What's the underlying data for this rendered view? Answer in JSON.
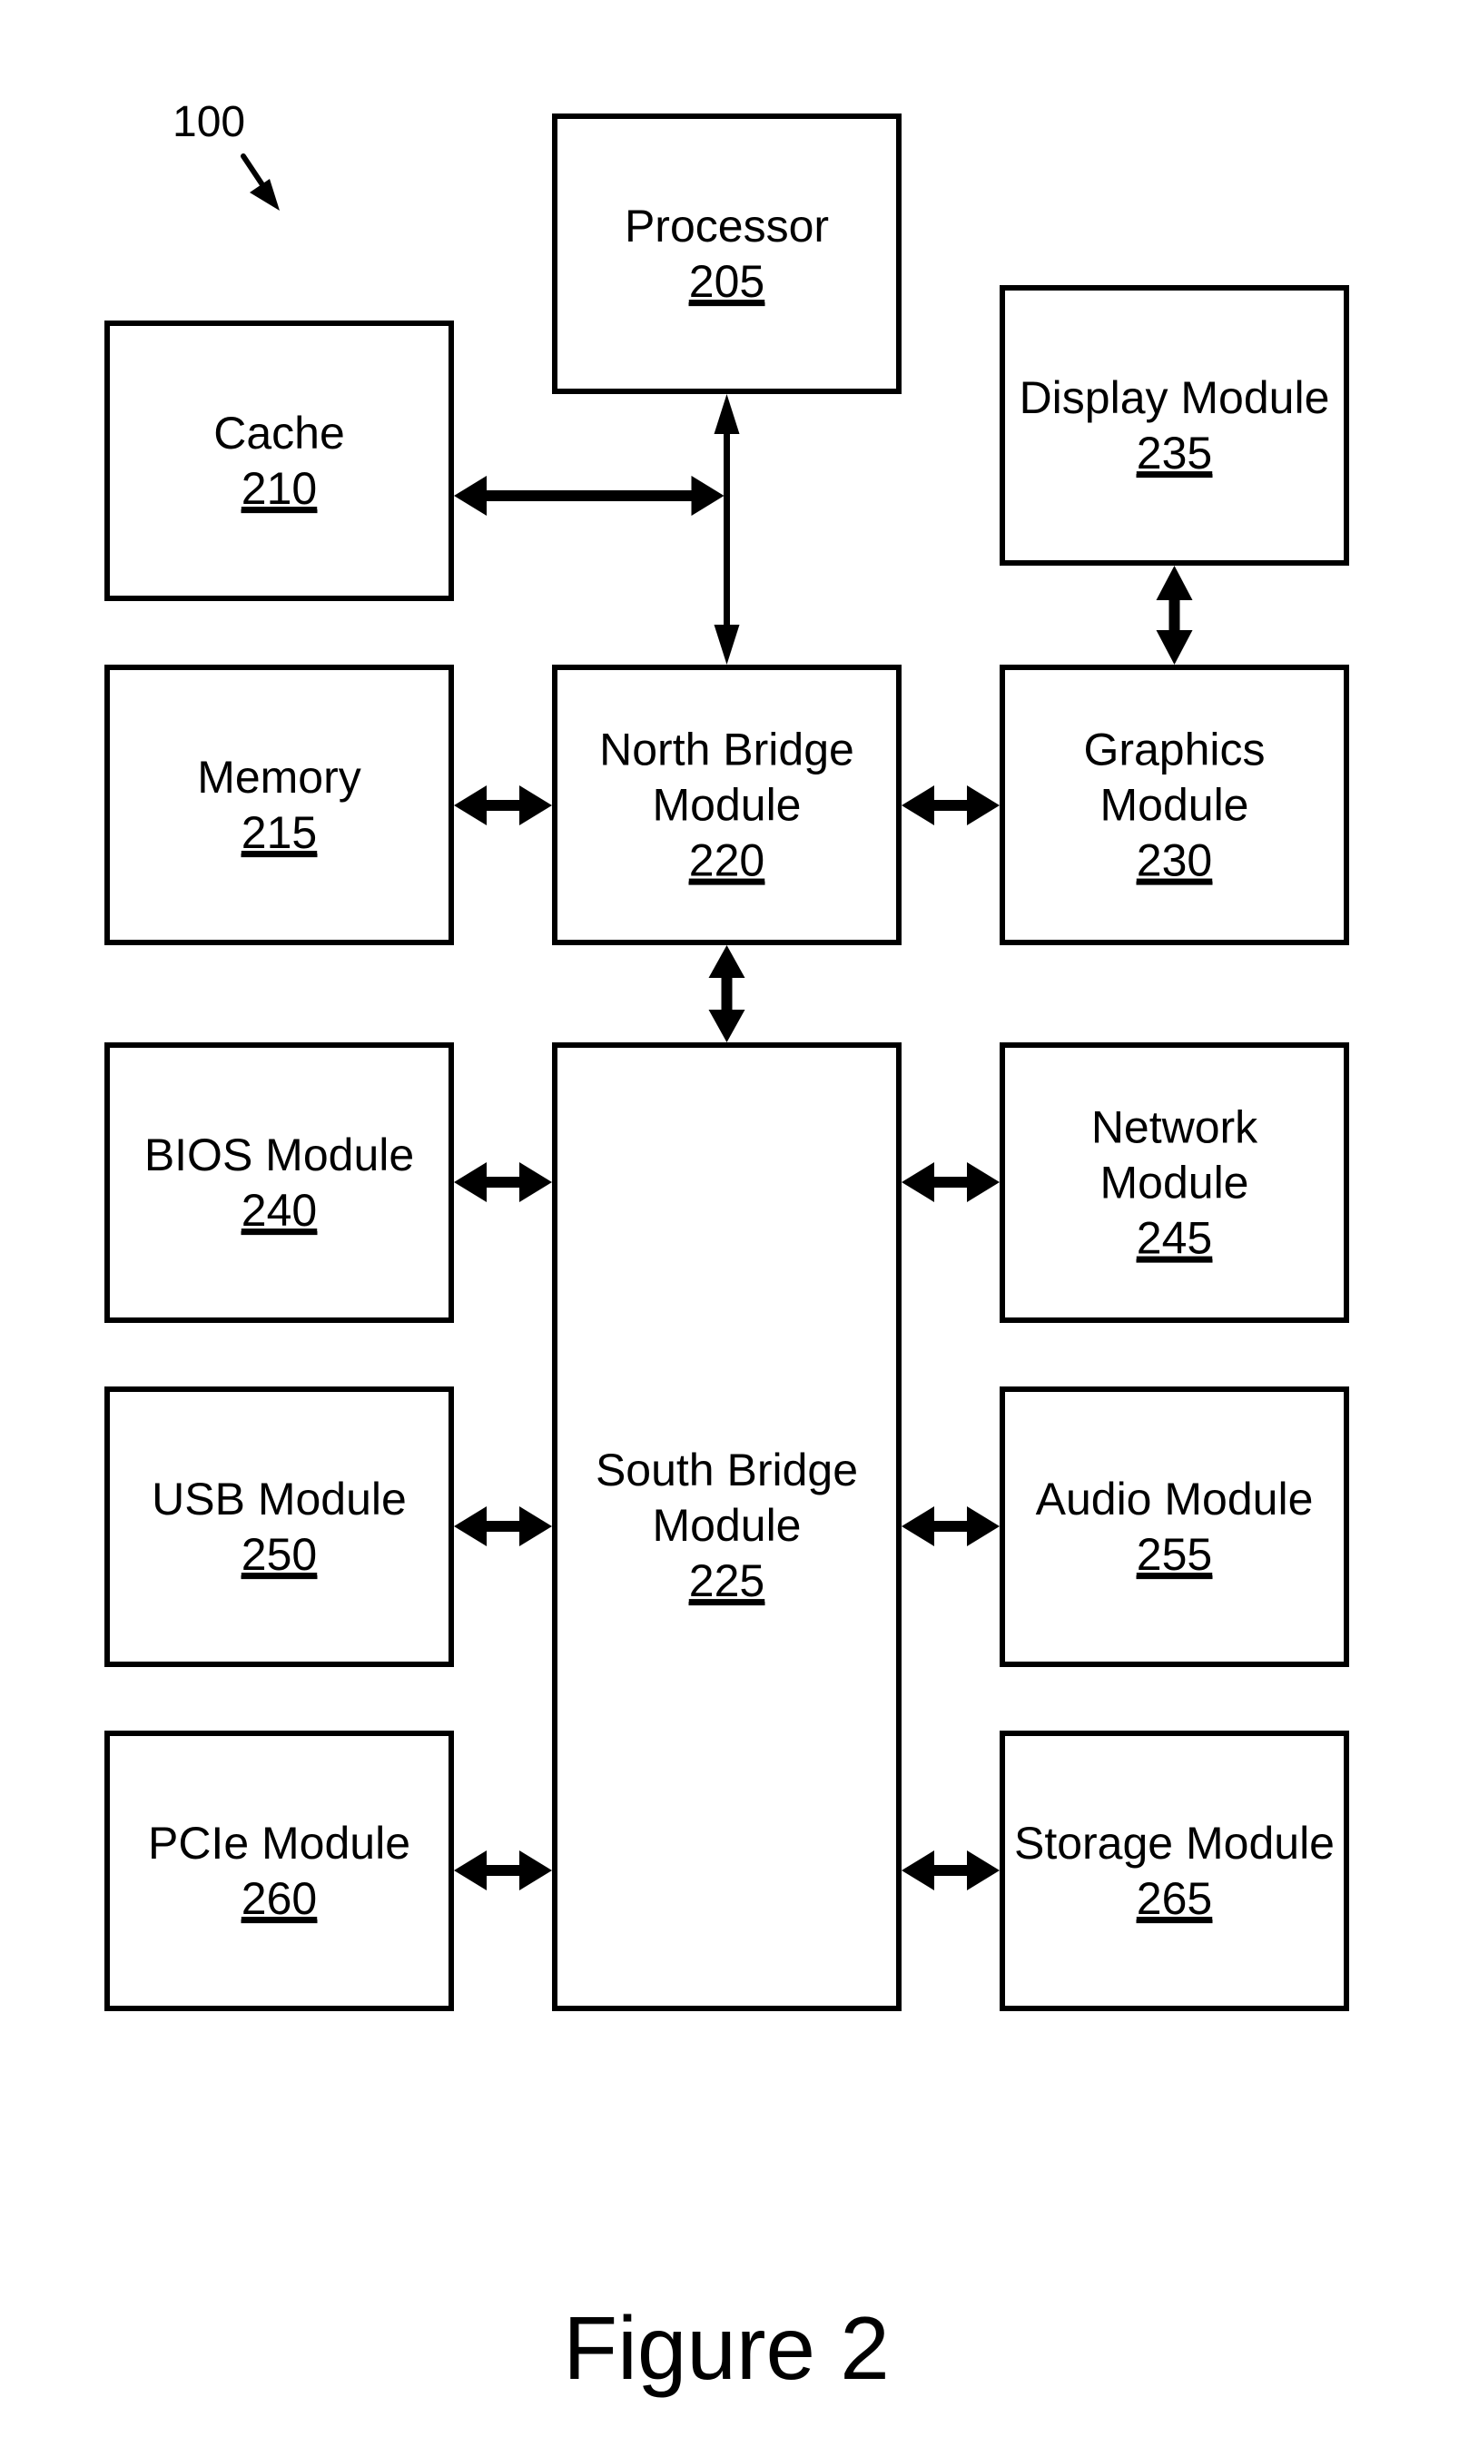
{
  "figure": {
    "caption": "Figure 2",
    "reference_label": "100"
  },
  "colors": {
    "stroke": "#000000",
    "background": "#ffffff"
  },
  "boxes": [
    {
      "id": "processor",
      "lines": [
        "Processor"
      ],
      "ref": "205"
    },
    {
      "id": "cache",
      "lines": [
        "Cache"
      ],
      "ref": "210"
    },
    {
      "id": "display",
      "lines": [
        "Display Module"
      ],
      "ref": "235"
    },
    {
      "id": "memory",
      "lines": [
        "Memory"
      ],
      "ref": "215"
    },
    {
      "id": "north-bridge",
      "lines": [
        "North Bridge",
        "Module"
      ],
      "ref": "220"
    },
    {
      "id": "graphics",
      "lines": [
        "Graphics",
        "Module"
      ],
      "ref": "230"
    },
    {
      "id": "bios",
      "lines": [
        "BIOS Module"
      ],
      "ref": "240"
    },
    {
      "id": "south-bridge",
      "lines": [
        "South Bridge",
        "Module"
      ],
      "ref": "225"
    },
    {
      "id": "network",
      "lines": [
        "Network",
        "Module"
      ],
      "ref": "245"
    },
    {
      "id": "usb",
      "lines": [
        "USB Module"
      ],
      "ref": "250"
    },
    {
      "id": "audio",
      "lines": [
        "Audio Module"
      ],
      "ref": "255"
    },
    {
      "id": "pcie",
      "lines": [
        "PCIe Module"
      ],
      "ref": "260"
    },
    {
      "id": "storage",
      "lines": [
        "Storage Module"
      ],
      "ref": "265"
    }
  ],
  "connections": [
    {
      "from": "processor",
      "to": "north-bridge",
      "type": "bidirectional"
    },
    {
      "from": "cache",
      "to": "processor-north-bridge-bus",
      "type": "bidirectional"
    },
    {
      "from": "display",
      "to": "graphics",
      "type": "bidirectional"
    },
    {
      "from": "memory",
      "to": "north-bridge",
      "type": "bidirectional"
    },
    {
      "from": "north-bridge",
      "to": "graphics",
      "type": "bidirectional"
    },
    {
      "from": "north-bridge",
      "to": "south-bridge",
      "type": "bidirectional"
    },
    {
      "from": "bios",
      "to": "south-bridge",
      "type": "bidirectional"
    },
    {
      "from": "south-bridge",
      "to": "network",
      "type": "bidirectional"
    },
    {
      "from": "usb",
      "to": "south-bridge",
      "type": "bidirectional"
    },
    {
      "from": "south-bridge",
      "to": "audio",
      "type": "bidirectional"
    },
    {
      "from": "pcie",
      "to": "south-bridge",
      "type": "bidirectional"
    },
    {
      "from": "south-bridge",
      "to": "storage",
      "type": "bidirectional"
    }
  ]
}
